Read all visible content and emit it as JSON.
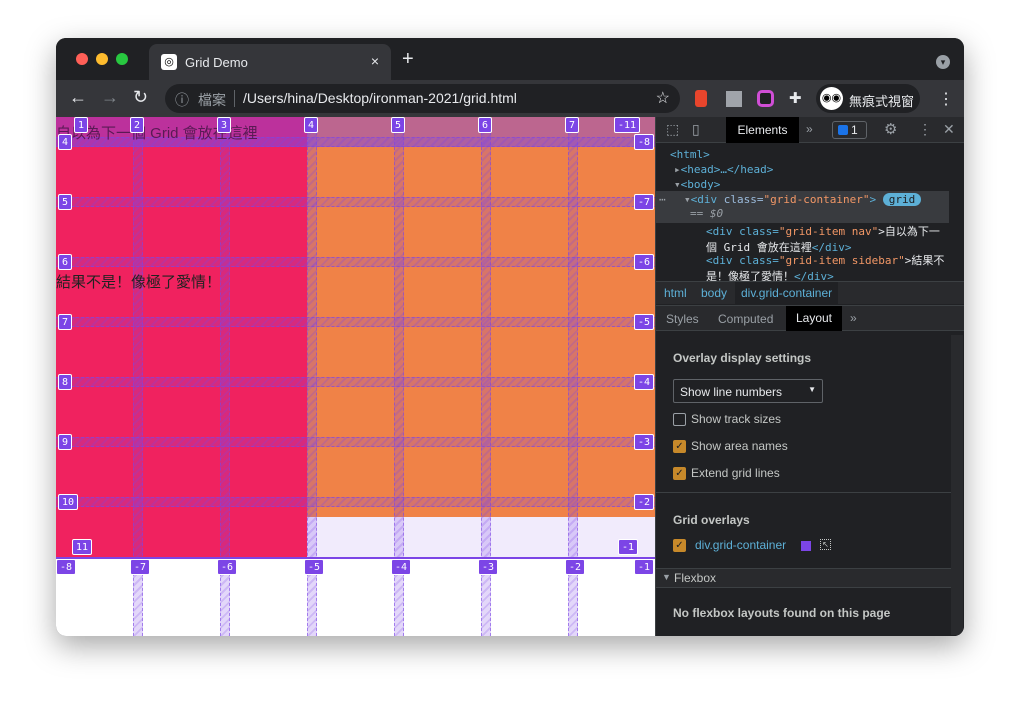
{
  "browser": {
    "tab_title": "Grid Demo",
    "close": "×",
    "new_tab": "+",
    "address_label": "檔案",
    "url": "/Users/hina/Desktop/ironman-2021/grid.html",
    "profile_label": "無痕式視窗",
    "icons": [
      "back-icon",
      "forward-icon",
      "reload-icon",
      "info-icon",
      "star-icon",
      "extension-icon",
      "incognito-icon",
      "more-icon"
    ]
  },
  "page": {
    "nav_text": "自以為下一個 Grid 會放在這裡",
    "sidebar_text": "結果不是！像極了愛情！",
    "colors": {
      "nav": "#f0225f",
      "content": "#f08247",
      "overlay": "#7c45e6",
      "empty": "#f1ebfc"
    },
    "top_labels": [
      "1",
      "2",
      "3",
      "4",
      "5",
      "6",
      "7",
      "-11"
    ],
    "left_labels": [
      "4",
      "5",
      "6",
      "7",
      "8",
      "9",
      "10"
    ],
    "right_labels": [
      "-8",
      "-7",
      "-6",
      "-5",
      "-4",
      "-3",
      "-2"
    ],
    "bottom_labels": [
      "-8",
      "-7",
      "-6",
      "-5",
      "-4",
      "-3",
      "-2",
      "-1"
    ],
    "corner_labels": [
      "11",
      "-1"
    ]
  },
  "devtools": {
    "tabs": {
      "elements": "Elements",
      "more": "»",
      "issues": "1"
    },
    "dom": {
      "html": "<html>",
      "head": "<head>…</head>",
      "body": "<body>",
      "div_open": "<div ",
      "cls_attr": "class=",
      "cls_val": "\"grid-container\"",
      "close_gt": ">",
      "badge": "grid",
      "eq": "== $0",
      "nav_line1_a": "<div class=",
      "nav_line1_b": "\"grid-item nav\"",
      "nav_line1_c": ">自以為下一",
      "nav_line2_a": "個 Grid 會放在這裡",
      "nav_line2_b": "</div>",
      "side_line1_a": "<div class=",
      "side_line1_b": "\"grid-item sidebar\"",
      "side_line1_c": ">結果不",
      "side_line2_a": "是！像極了愛情！",
      "side_line2_b": "</div>"
    },
    "breadcrumbs": [
      "html",
      "body",
      "div.grid-container"
    ],
    "subtabs": [
      "Styles",
      "Computed",
      "Layout",
      "»"
    ],
    "layout": {
      "overlay_title": "Overlay display settings",
      "select_value": "Show line numbers",
      "options": [
        {
          "label": "Show track sizes",
          "checked": false
        },
        {
          "label": "Show area names",
          "checked": true
        },
        {
          "label": "Extend grid lines",
          "checked": true
        }
      ],
      "grid_overlays_title": "Grid overlays",
      "overlay_item": "div.grid-container",
      "overlay_checked": true,
      "overlay_color": "#7c45e6",
      "flexbox_title": "Flexbox",
      "flexbox_empty": "No flexbox layouts found on this page"
    }
  }
}
